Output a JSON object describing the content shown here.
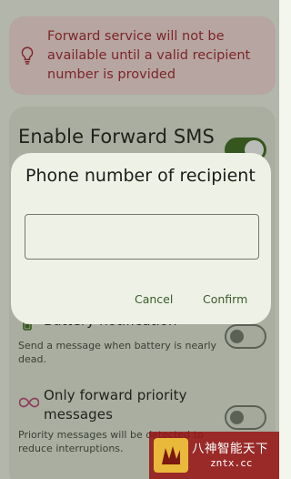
{
  "banner": {
    "icon": "lightbulb-icon",
    "message": "Forward service will not be available until a valid recipient number is provided",
    "text_color": "#a5232f",
    "background": "#f9dedc"
  },
  "settings": {
    "enable_forward": {
      "title": "Enable Forward SMS",
      "enabled": true
    },
    "battery": {
      "title": "Battery notification",
      "description": "Send a message when battery is nearly dead.",
      "enabled": false,
      "icon": "battery-icon"
    },
    "priority": {
      "title": "Only forward priority messages",
      "description": "Priority messages will be detected to reduce interruptions.",
      "enabled": false,
      "icon": "infinity-icon"
    }
  },
  "dialog": {
    "title": "Phone number of recipient",
    "input_value": "",
    "cancel_label": "Cancel",
    "confirm_label": "Confirm"
  },
  "watermark": {
    "chinese_text": "八神智能天下",
    "url": "zntx.cc"
  },
  "colors": {
    "accent": "#3c6a1e",
    "surface": "#e6ebdc",
    "dialog_surface": "#eef2e6"
  }
}
